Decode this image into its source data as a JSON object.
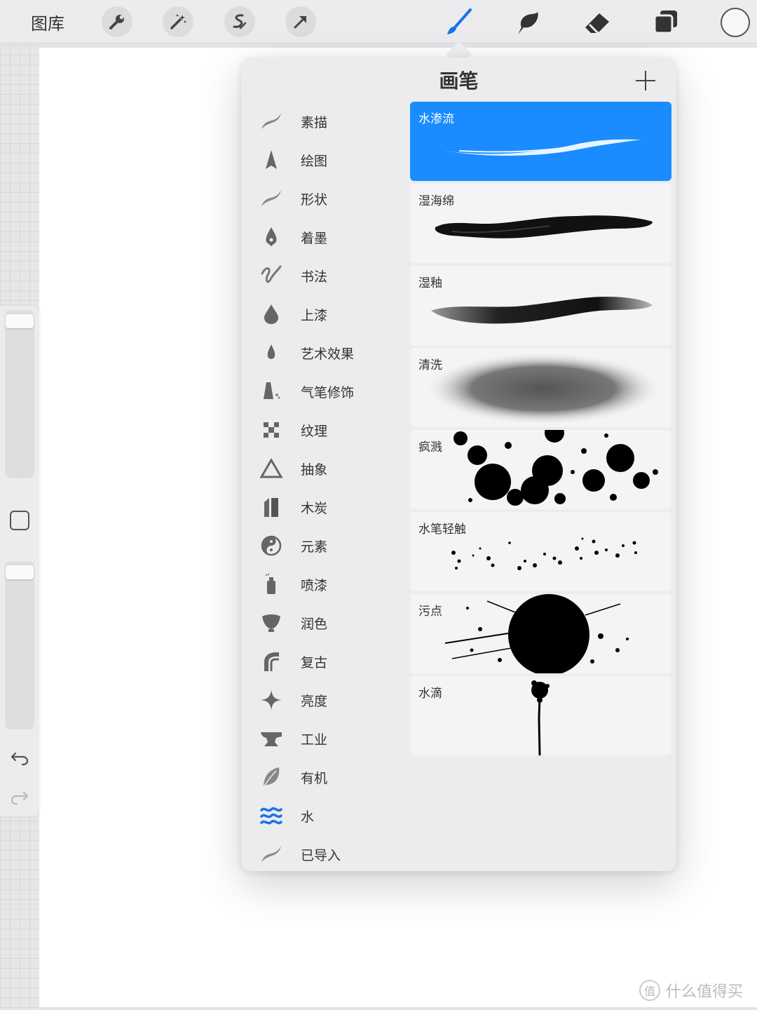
{
  "toolbar": {
    "gallery_label": "图库",
    "left_tools": [
      "wrench-icon",
      "magic-wand-icon",
      "selection-icon",
      "transform-icon"
    ],
    "right_tools": [
      "brush-icon",
      "smudge-icon",
      "eraser-icon",
      "layers-icon"
    ],
    "active_tool": "brush-icon",
    "active_color": "#1a73e8"
  },
  "popover": {
    "title": "画笔",
    "categories": [
      {
        "label": "素描",
        "icon": "sketching-icon"
      },
      {
        "label": "绘图",
        "icon": "inking-icon"
      },
      {
        "label": "形状",
        "icon": "shape-icon"
      },
      {
        "label": "着墨",
        "icon": "pen-nib-icon"
      },
      {
        "label": "书法",
        "icon": "calligraphy-icon"
      },
      {
        "label": "上漆",
        "icon": "paint-drop-icon"
      },
      {
        "label": "艺术效果",
        "icon": "artistic-icon"
      },
      {
        "label": "气笔修饰",
        "icon": "airbrush-icon"
      },
      {
        "label": "纹理",
        "icon": "texture-icon"
      },
      {
        "label": "抽象",
        "icon": "abstract-icon"
      },
      {
        "label": "木炭",
        "icon": "charcoal-icon"
      },
      {
        "label": "元素",
        "icon": "elements-icon"
      },
      {
        "label": "喷漆",
        "icon": "spray-can-icon"
      },
      {
        "label": "润色",
        "icon": "touchup-icon"
      },
      {
        "label": "复古",
        "icon": "retro-icon"
      },
      {
        "label": "亮度",
        "icon": "sparkle-icon"
      },
      {
        "label": "工业",
        "icon": "anvil-icon"
      },
      {
        "label": "有机",
        "icon": "leaf-icon"
      },
      {
        "label": "水",
        "icon": "water-waves-icon"
      },
      {
        "label": "已导入",
        "icon": "imported-icon"
      }
    ],
    "active_category": "水",
    "brushes": [
      {
        "label": "水渗流",
        "selected": true
      },
      {
        "label": "湿海绵",
        "selected": false
      },
      {
        "label": "湿釉",
        "selected": false
      },
      {
        "label": "清洗",
        "selected": false
      },
      {
        "label": "疯溅",
        "selected": false
      },
      {
        "label": "水笔轻触",
        "selected": false
      },
      {
        "label": "污点",
        "selected": false
      },
      {
        "label": "水滴",
        "selected": false
      }
    ],
    "selected_color": "#1a8cff"
  },
  "watermark": {
    "text": "什么值得买",
    "icon_char": "值"
  }
}
